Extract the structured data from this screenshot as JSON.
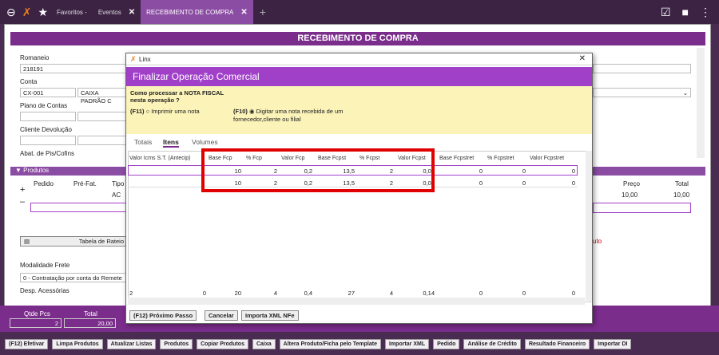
{
  "topbar": {
    "tabs": [
      {
        "label": "Favoritos",
        "suffix": "-"
      },
      {
        "label": "Eventos",
        "close": "✕"
      },
      {
        "label": "RECEBIMENTO DE COMPRA",
        "close": "✕"
      }
    ],
    "add": "+"
  },
  "main": {
    "title": "RECEBIMENTO DE COMPRA",
    "romaneio_label": "Romaneio",
    "romaneio_value": "218191",
    "conta_label": "Conta",
    "conta_code": "CX-001",
    "conta_name": "CAIXA PADRÃO C",
    "plano_label": "Plano de Contas",
    "cliente_label": "Cliente Devolução",
    "abat_label": "Abat. de Pis/Cofins",
    "produtos_label": "▼ Produtos",
    "prod_cols": [
      "Pedido",
      "Pré-Fat.",
      "Tipo"
    ],
    "prod_tipo": "AC",
    "preco_label": "Preço",
    "total_label": "Total",
    "preco_value": "10,00",
    "total_value": "10,00",
    "rateio_label": "Tabela de Rateio",
    "modalidade_label": "Modalidade Frete",
    "modalidade_value": "0 - Contratação por conta do Remete",
    "desp_label": "Desp. Acessórias",
    "red_text": "uto",
    "qtde_label": "Qtde Pcs",
    "qtde_value": "2",
    "total2_label": "Total",
    "total2_value": "20,00"
  },
  "dialog": {
    "app": "Linx",
    "close": "✕",
    "title": "Finalizar Operação Comercial",
    "question": "Como processar a NOTA FISCAL nesta operação ?",
    "opt1_key": "(F11)",
    "opt1_label": "Imprimir uma nota",
    "opt2_key": "(F10)",
    "opt2_label": "Digitar uma nota recebida de um fornecedor,cliente ou filial",
    "tabs": [
      "Totais",
      "Itens",
      "Volumes"
    ],
    "columns": [
      "Valor Icms S.T. (Antecip)",
      "Base Fcp",
      "% Fcp",
      "Valor Fcp",
      "Base Fcpst",
      "% Fcpst",
      "Valor Fcpst",
      "Base Fcpstret",
      "% Fcpstret",
      "Valor Fcpstret"
    ],
    "rows": [
      [
        "",
        "10",
        "2",
        "0,2",
        "13,5",
        "2",
        "0,07",
        "0",
        "0",
        "0"
      ],
      [
        "",
        "10",
        "2",
        "0,2",
        "13,5",
        "2",
        "0,07",
        "0",
        "0",
        "0"
      ]
    ],
    "totals": [
      "2",
      "0",
      "20",
      "4",
      "0,4",
      "27",
      "4",
      "0,14",
      "0",
      "0",
      "0"
    ],
    "buttons": [
      "(F12) Próximo Passo",
      "Cancelar",
      "Importa XML NFe"
    ]
  },
  "bottom": [
    "(F12) Efetivar",
    "Limpa Produtos",
    "Atualizar Listas",
    "Produtos",
    "Copiar Produtos",
    "Caixa",
    "Altera Produto/Ficha pelo Template",
    "Importar XML",
    "Pedido",
    "Análise de Crédito",
    "Resultado Financeiro",
    "Importar DI"
  ],
  "colors": {
    "purple": "#7b2d8c",
    "accent": "#a040c8",
    "highlight": "#e00000"
  }
}
